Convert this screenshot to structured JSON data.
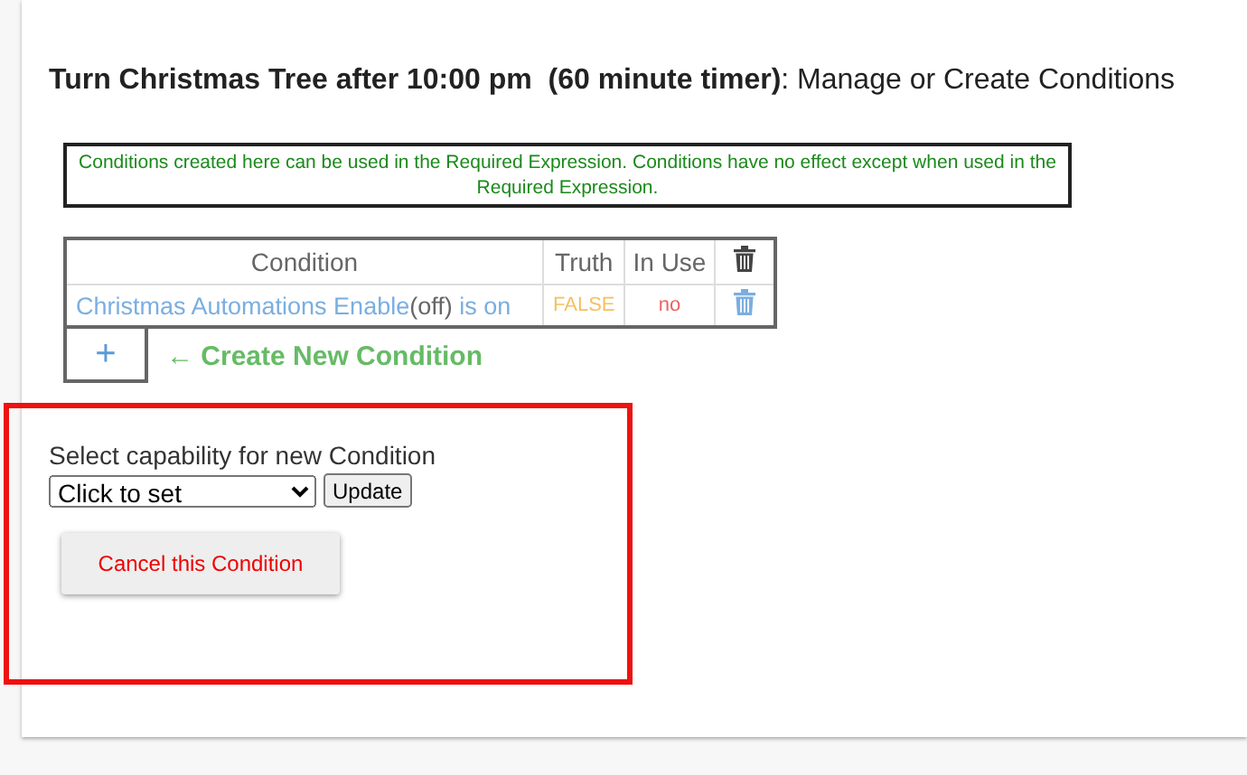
{
  "title": "**Turn Christmas Tree after 10:00 pm  (60 minute timer)**: Manage or Create Conditions",
  "note": "Conditions created here can be used in the Required Expression.  Conditions have no effect except when used in the Required Expression.",
  "table": {
    "columns": [
      "Condition",
      "Truth",
      "In Use"
    ],
    "rows": [
      {
        "device": "Christmas Automations Enable",
        "state": "(off)",
        "suffix": "is on",
        "truth": "FALSE",
        "in_use": "no"
      }
    ]
  },
  "add_button": "+",
  "create_link": "← Create New Condition",
  "capability": {
    "label": "Select capability for new Condition",
    "select_value": "Click to set",
    "update_button": "Update"
  },
  "cancel_button": "Cancel this Condition",
  "highlight": true
}
